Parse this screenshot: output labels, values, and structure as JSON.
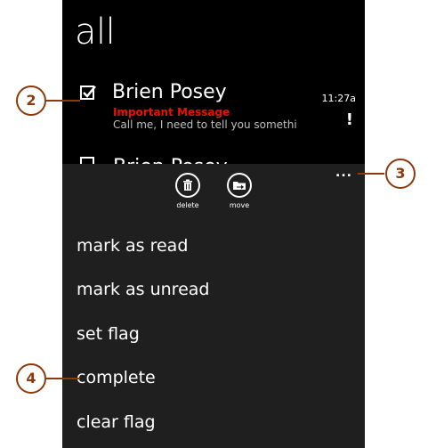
{
  "pivot": {
    "title": "all"
  },
  "message": {
    "sender": "Brien Posey",
    "subject": "Important Message",
    "preview": "Call me, I need to tell you somethi",
    "time": "11:27a",
    "importance": "!"
  },
  "ghost_message": {
    "sender": "Brien Posey"
  },
  "appbar": {
    "ellipsis": "...",
    "buttons": [
      {
        "label": "delete",
        "icon": "trash-icon"
      },
      {
        "label": "move",
        "icon": "folder-move-icon"
      }
    ],
    "menu_items": [
      {
        "label": "mark as read"
      },
      {
        "label": "mark as unread"
      },
      {
        "label": "set flag"
      },
      {
        "label": "complete"
      },
      {
        "label": "clear flag"
      }
    ]
  },
  "callouts": {
    "c2": "2",
    "c3": "3",
    "c4": "4"
  },
  "colors": {
    "background": "#000000",
    "appbar": "#1f1f1f",
    "accent_red": "#e51400",
    "callout": "#8b3a0e"
  }
}
